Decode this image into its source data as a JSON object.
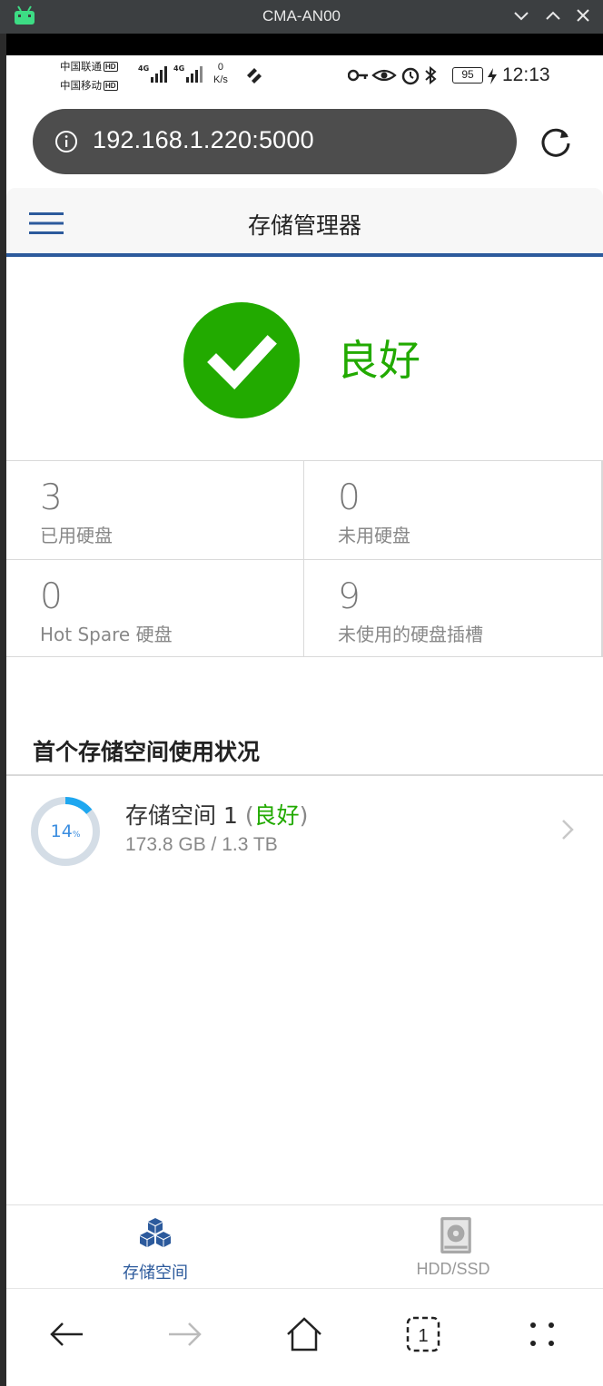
{
  "emulator": {
    "title": "CMA-AN00"
  },
  "status_bar": {
    "carrier1": "中国联通",
    "carrier2": "中国移动",
    "hd": "HD",
    "net1": "4G",
    "net2": "4G",
    "speed_value": "0",
    "speed_unit": "K/s",
    "battery": "95",
    "time": "12:13"
  },
  "browser": {
    "url": "192.168.1.220:5000"
  },
  "app": {
    "title": "存储管理器",
    "health": "良好"
  },
  "stats": [
    {
      "value": "3",
      "label": "已用硬盘"
    },
    {
      "value": "0",
      "label": "未用硬盘"
    },
    {
      "value": "0",
      "label": "Hot Spare 硬盘"
    },
    {
      "value": "9",
      "label": "未使用的硬盘插槽"
    }
  ],
  "section": {
    "title": "首个存储空间使用状况"
  },
  "pool": {
    "name": "存储空间 1",
    "paren_open": "(",
    "status": "良好",
    "paren_close": ")",
    "usage_percent": 14,
    "usage_text": "14",
    "percent_sign": "%",
    "size": "173.8 GB / 1.3 TB"
  },
  "tabs": [
    {
      "label": "存储空间",
      "icon": "cubes-icon",
      "active": true
    },
    {
      "label": "HDD/SSD",
      "icon": "hard-disk-icon",
      "active": false
    }
  ],
  "colors": {
    "accent": "#2c5a9c",
    "good": "#22aa00",
    "donut": "#1ea7f0"
  }
}
